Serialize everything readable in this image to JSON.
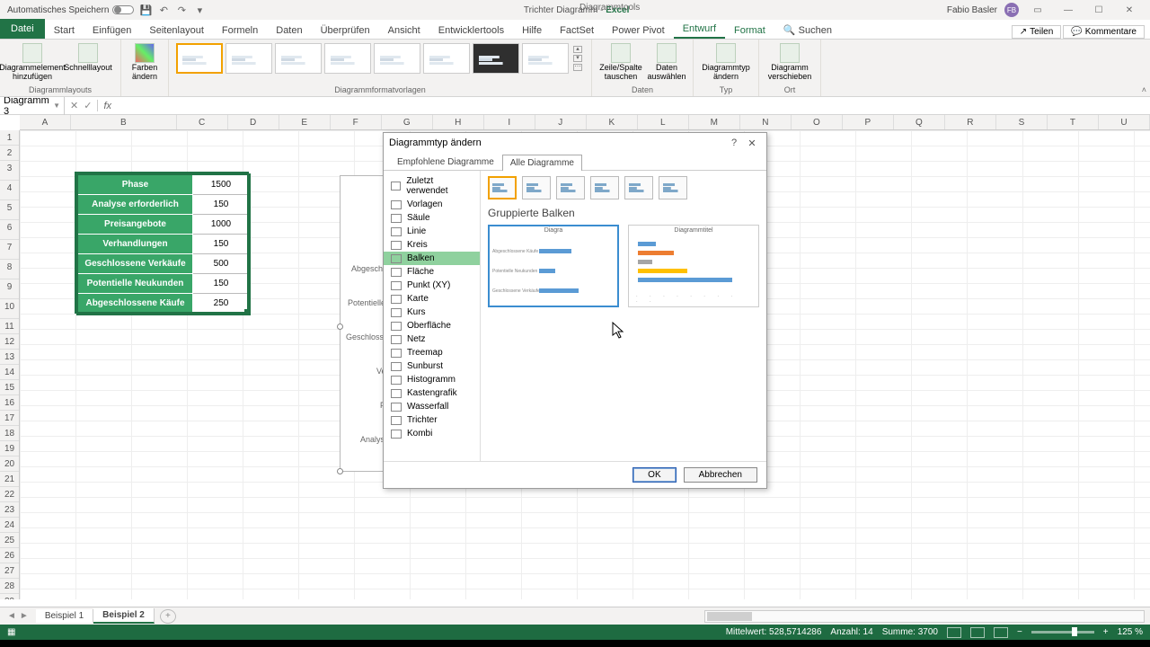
{
  "titlebar": {
    "autosave": "Automatisches Speichern",
    "doc_title": "Trichter Diagramm",
    "app_name": "Excel",
    "tool_context": "Diagrammtools",
    "user_name": "Fabio Basler",
    "user_initials": "FB"
  },
  "ribbon_tabs": {
    "file": "Datei",
    "tabs": [
      "Start",
      "Einfügen",
      "Seitenlayout",
      "Formeln",
      "Daten",
      "Überprüfen",
      "Ansicht",
      "Entwicklertools",
      "Hilfe",
      "FactSet",
      "Power Pivot",
      "Entwurf",
      "Format"
    ],
    "active": "Entwurf",
    "search": "Suchen",
    "share": "Teilen",
    "comments": "Kommentare"
  },
  "ribbon": {
    "g1": {
      "btn1": "Diagrammelement hinzufügen",
      "btn2": "Schnelllayout",
      "label": "Diagrammlayouts"
    },
    "g2": {
      "btn": "Farben ändern"
    },
    "g3": {
      "label": "Diagrammformatvorlagen"
    },
    "g4": {
      "btn1": "Zeile/Spalte tauschen",
      "btn2": "Daten auswählen",
      "label": "Daten"
    },
    "g5": {
      "btn": "Diagrammtyp ändern",
      "label": "Typ"
    },
    "g6": {
      "btn": "Diagramm verschieben",
      "label": "Ort"
    }
  },
  "namebox": "Diagramm 3",
  "columns": [
    "A",
    "B",
    "C",
    "D",
    "E",
    "F",
    "G",
    "H",
    "I",
    "J",
    "K",
    "L",
    "M",
    "N",
    "O",
    "P",
    "Q",
    "R",
    "S",
    "T",
    "U"
  ],
  "rows_count": 30,
  "table": {
    "header": {
      "phase": "Phase",
      "value": ""
    },
    "rows": [
      {
        "phase": "Phase",
        "value": "1500"
      },
      {
        "phase": "Analyse erforderlich",
        "value": "150"
      },
      {
        "phase": "Preisangebote",
        "value": "1000"
      },
      {
        "phase": "Verhandlungen",
        "value": "150"
      },
      {
        "phase": "Geschlossene Verkäufe",
        "value": "500"
      },
      {
        "phase": "Potentielle Neukunden",
        "value": "150"
      },
      {
        "phase": "Abgeschlossene Käufe",
        "value": "250"
      }
    ]
  },
  "chart_bg": {
    "labels": [
      "Abgeschloss",
      "Potentielle Neu",
      "Geschlossene V",
      "Verhan",
      "Preisa",
      "Analyse erfo"
    ]
  },
  "dialog": {
    "title": "Diagrammtyp ändern",
    "tab_rec": "Empfohlene Diagramme",
    "tab_all": "Alle Diagramme",
    "categories": [
      "Zuletzt verwendet",
      "Vorlagen",
      "Säule",
      "Linie",
      "Kreis",
      "Balken",
      "Fläche",
      "Punkt (XY)",
      "Karte",
      "Kurs",
      "Oberfläche",
      "Netz",
      "Treemap",
      "Sunburst",
      "Histogramm",
      "Kastengrafik",
      "Wasserfall",
      "Trichter",
      "Kombi"
    ],
    "selected_category_index": 5,
    "subtype_title": "Gruppierte Balken",
    "preview1_title": "Diagra",
    "preview1_labels": [
      "Abgeschlossene Käufe",
      "Potentielle Neukunden",
      "Geschlossene Verkäufe"
    ],
    "preview2_title": "Diagrammtitel",
    "ok": "OK",
    "cancel": "Abbrechen"
  },
  "sheets": {
    "nav": [
      "◄",
      "►"
    ],
    "tabs": [
      "Beispiel 1",
      "Beispiel 2"
    ],
    "active_index": 1
  },
  "statusbar": {
    "ready_icon": "�目",
    "avg": "Mittelwert: 528,5714286",
    "count": "Anzahl: 14",
    "sum": "Summe: 3700",
    "zoom": "125 %"
  },
  "chart_data": {
    "type": "bar",
    "title": "Diagrammtitel",
    "categories": [
      "Analyse erforderlich",
      "Preisangebote",
      "Verhandlungen",
      "Geschlossene Verkäufe",
      "Potentielle Neukunden",
      "Abgeschlossene Käufe"
    ],
    "values": [
      150,
      1000,
      150,
      500,
      150,
      250
    ],
    "xlabel": "",
    "ylabel": "",
    "xlim": [
      0,
      1600
    ]
  }
}
